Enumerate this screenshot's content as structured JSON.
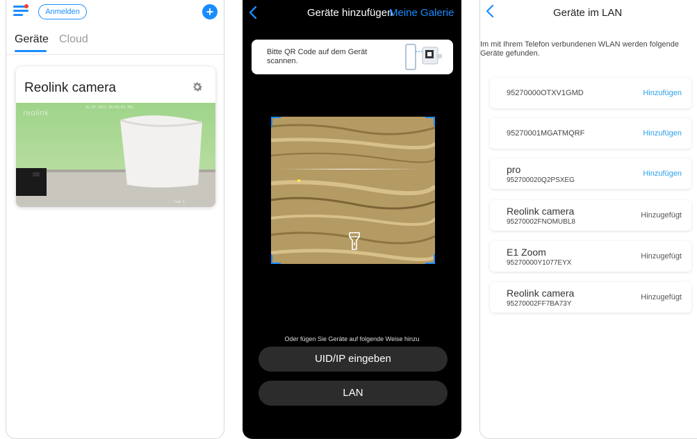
{
  "screen1": {
    "login_label": "Anmelden",
    "tabs": [
      {
        "label": "Geräte",
        "active": true
      },
      {
        "label": "Cloud",
        "active": false
      }
    ],
    "camera_card": {
      "title": "Reolink camera"
    }
  },
  "screen2": {
    "title": "Geräte hinzufügen",
    "gallery_link": "Meine Galerie",
    "qr_hint": "Bitte QR Code auf dem Gerät scannen.",
    "alt_text": "Oder fügen Sie Geräte auf folgende Weise hinzu",
    "uid_button": "UID/IP eingeben",
    "lan_button": "LAN"
  },
  "screen3": {
    "title": "Geräte im LAN",
    "hint": "Im mit Ihrem Telefon verbundenen WLAN werden folgende Geräte gefunden.",
    "devices": [
      {
        "name": "",
        "uid": "95270000OTXV1GMD",
        "action": "Hinzufügen"
      },
      {
        "name": "",
        "uid": "95270001MGATMQRF",
        "action": "Hinzufügen"
      },
      {
        "name": "pro",
        "uid": "952700020Q2PSXEG",
        "action": "Hinzufügen"
      },
      {
        "name": "Reolink camera",
        "uid": "95270002FNOMUBL8",
        "action": "Hinzugefügt"
      },
      {
        "name": "E1 Zoom",
        "uid": "95270000Y1077EYX",
        "action": "Hinzugefügt"
      },
      {
        "name": "Reolink camera",
        "uid": "95270002FF7BA73Y",
        "action": "Hinzugefügt"
      }
    ]
  },
  "colors": {
    "accent": "#1a8cff",
    "add_action": "#2aa0e8",
    "badge_red": "#ff3b30"
  }
}
